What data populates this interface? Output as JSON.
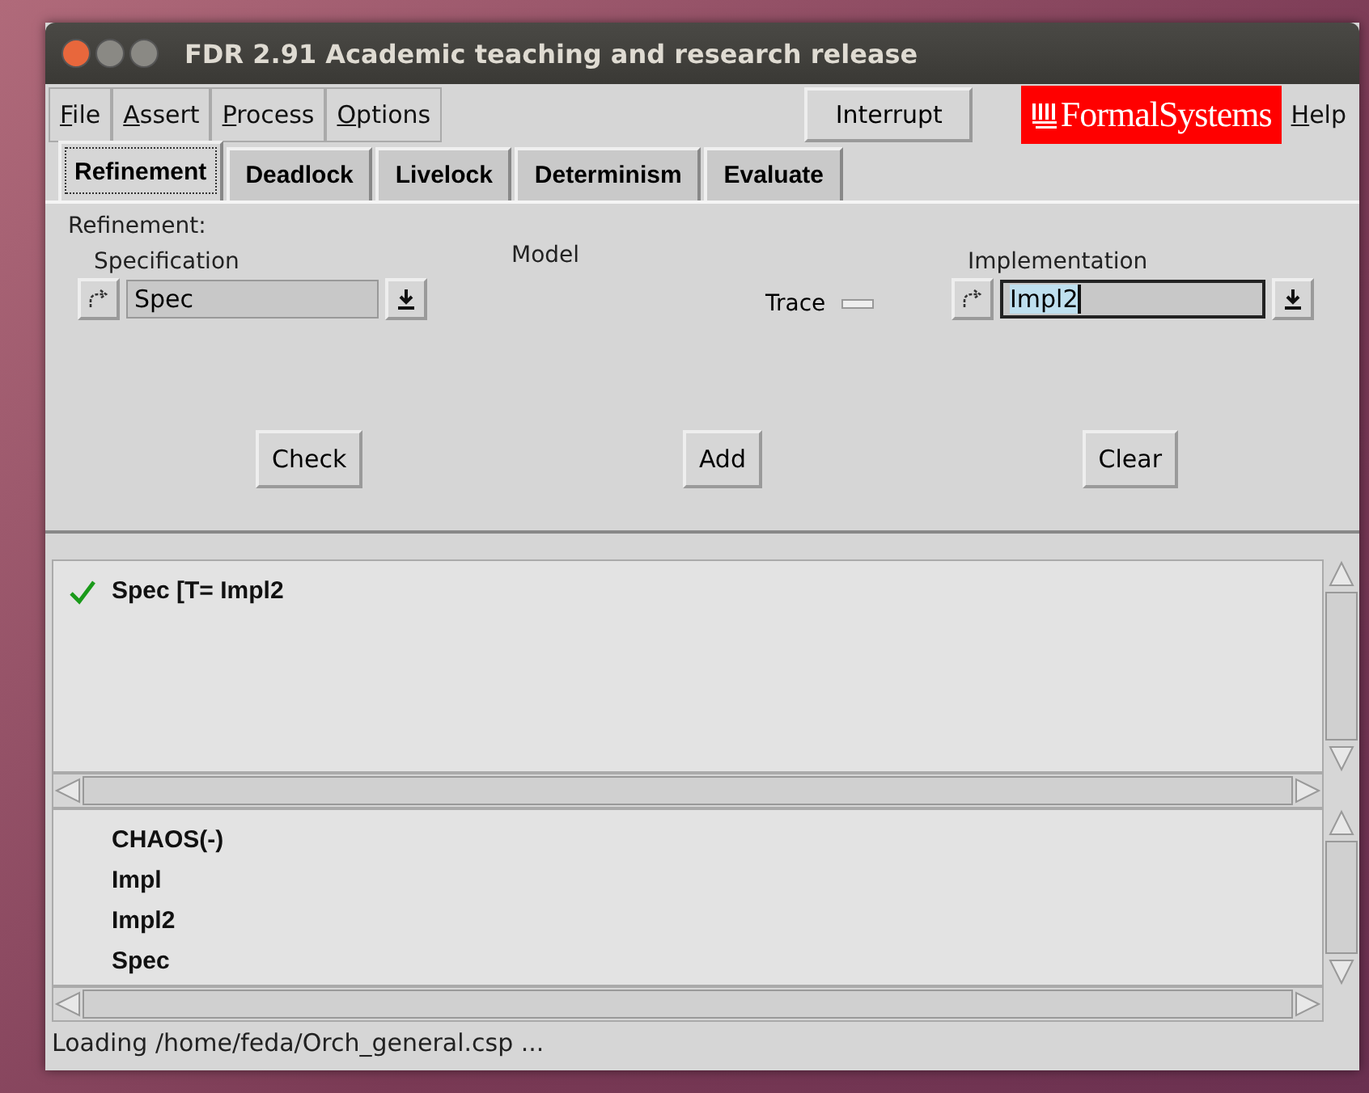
{
  "window": {
    "title": "FDR 2.91 Academic teaching and research release"
  },
  "menu": [
    "File",
    "Assert",
    "Process",
    "Options"
  ],
  "interrupt_button": "Interrupt",
  "logo": "FormalSystems",
  "help_menu": "Help",
  "tabs": [
    {
      "label": "Refinement",
      "selected": true
    },
    {
      "label": "Deadlock",
      "selected": false
    },
    {
      "label": "Livelock",
      "selected": false
    },
    {
      "label": "Determinism",
      "selected": false
    },
    {
      "label": "Evaluate",
      "selected": false
    }
  ],
  "refinement": {
    "heading": "Refinement:",
    "specification": {
      "label": "Specification",
      "value": "Spec",
      "focused": false
    },
    "model": {
      "label": "Model",
      "value": "Trace"
    },
    "implementation": {
      "label": "Implementation",
      "value": "Impl2",
      "focused": true
    },
    "buttons": [
      "Check",
      "Add",
      "Clear"
    ]
  },
  "results": [
    {
      "text": "Spec [T= Impl2",
      "passed": true
    }
  ],
  "processes": [
    "CHAOS(-)",
    "Impl",
    "Impl2",
    "Spec"
  ],
  "status_bar": "Loading /home/feda/Orch_general.csp ..."
}
